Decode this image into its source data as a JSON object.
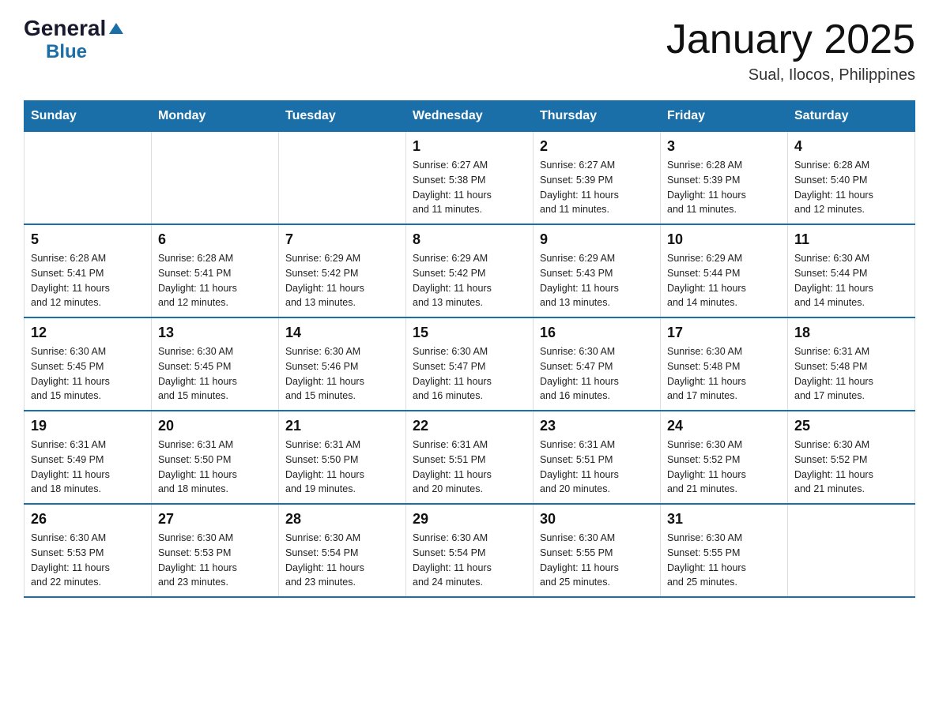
{
  "header": {
    "logo": {
      "general": "General",
      "blue": "Blue",
      "arrow": "▲"
    },
    "title": "January 2025",
    "subtitle": "Sual, Ilocos, Philippines"
  },
  "columns": [
    "Sunday",
    "Monday",
    "Tuesday",
    "Wednesday",
    "Thursday",
    "Friday",
    "Saturday"
  ],
  "weeks": [
    [
      {
        "day": "",
        "info": ""
      },
      {
        "day": "",
        "info": ""
      },
      {
        "day": "",
        "info": ""
      },
      {
        "day": "1",
        "info": "Sunrise: 6:27 AM\nSunset: 5:38 PM\nDaylight: 11 hours\nand 11 minutes."
      },
      {
        "day": "2",
        "info": "Sunrise: 6:27 AM\nSunset: 5:39 PM\nDaylight: 11 hours\nand 11 minutes."
      },
      {
        "day": "3",
        "info": "Sunrise: 6:28 AM\nSunset: 5:39 PM\nDaylight: 11 hours\nand 11 minutes."
      },
      {
        "day": "4",
        "info": "Sunrise: 6:28 AM\nSunset: 5:40 PM\nDaylight: 11 hours\nand 12 minutes."
      }
    ],
    [
      {
        "day": "5",
        "info": "Sunrise: 6:28 AM\nSunset: 5:41 PM\nDaylight: 11 hours\nand 12 minutes."
      },
      {
        "day": "6",
        "info": "Sunrise: 6:28 AM\nSunset: 5:41 PM\nDaylight: 11 hours\nand 12 minutes."
      },
      {
        "day": "7",
        "info": "Sunrise: 6:29 AM\nSunset: 5:42 PM\nDaylight: 11 hours\nand 13 minutes."
      },
      {
        "day": "8",
        "info": "Sunrise: 6:29 AM\nSunset: 5:42 PM\nDaylight: 11 hours\nand 13 minutes."
      },
      {
        "day": "9",
        "info": "Sunrise: 6:29 AM\nSunset: 5:43 PM\nDaylight: 11 hours\nand 13 minutes."
      },
      {
        "day": "10",
        "info": "Sunrise: 6:29 AM\nSunset: 5:44 PM\nDaylight: 11 hours\nand 14 minutes."
      },
      {
        "day": "11",
        "info": "Sunrise: 6:30 AM\nSunset: 5:44 PM\nDaylight: 11 hours\nand 14 minutes."
      }
    ],
    [
      {
        "day": "12",
        "info": "Sunrise: 6:30 AM\nSunset: 5:45 PM\nDaylight: 11 hours\nand 15 minutes."
      },
      {
        "day": "13",
        "info": "Sunrise: 6:30 AM\nSunset: 5:45 PM\nDaylight: 11 hours\nand 15 minutes."
      },
      {
        "day": "14",
        "info": "Sunrise: 6:30 AM\nSunset: 5:46 PM\nDaylight: 11 hours\nand 15 minutes."
      },
      {
        "day": "15",
        "info": "Sunrise: 6:30 AM\nSunset: 5:47 PM\nDaylight: 11 hours\nand 16 minutes."
      },
      {
        "day": "16",
        "info": "Sunrise: 6:30 AM\nSunset: 5:47 PM\nDaylight: 11 hours\nand 16 minutes."
      },
      {
        "day": "17",
        "info": "Sunrise: 6:30 AM\nSunset: 5:48 PM\nDaylight: 11 hours\nand 17 minutes."
      },
      {
        "day": "18",
        "info": "Sunrise: 6:31 AM\nSunset: 5:48 PM\nDaylight: 11 hours\nand 17 minutes."
      }
    ],
    [
      {
        "day": "19",
        "info": "Sunrise: 6:31 AM\nSunset: 5:49 PM\nDaylight: 11 hours\nand 18 minutes."
      },
      {
        "day": "20",
        "info": "Sunrise: 6:31 AM\nSunset: 5:50 PM\nDaylight: 11 hours\nand 18 minutes."
      },
      {
        "day": "21",
        "info": "Sunrise: 6:31 AM\nSunset: 5:50 PM\nDaylight: 11 hours\nand 19 minutes."
      },
      {
        "day": "22",
        "info": "Sunrise: 6:31 AM\nSunset: 5:51 PM\nDaylight: 11 hours\nand 20 minutes."
      },
      {
        "day": "23",
        "info": "Sunrise: 6:31 AM\nSunset: 5:51 PM\nDaylight: 11 hours\nand 20 minutes."
      },
      {
        "day": "24",
        "info": "Sunrise: 6:30 AM\nSunset: 5:52 PM\nDaylight: 11 hours\nand 21 minutes."
      },
      {
        "day": "25",
        "info": "Sunrise: 6:30 AM\nSunset: 5:52 PM\nDaylight: 11 hours\nand 21 minutes."
      }
    ],
    [
      {
        "day": "26",
        "info": "Sunrise: 6:30 AM\nSunset: 5:53 PM\nDaylight: 11 hours\nand 22 minutes."
      },
      {
        "day": "27",
        "info": "Sunrise: 6:30 AM\nSunset: 5:53 PM\nDaylight: 11 hours\nand 23 minutes."
      },
      {
        "day": "28",
        "info": "Sunrise: 6:30 AM\nSunset: 5:54 PM\nDaylight: 11 hours\nand 23 minutes."
      },
      {
        "day": "29",
        "info": "Sunrise: 6:30 AM\nSunset: 5:54 PM\nDaylight: 11 hours\nand 24 minutes."
      },
      {
        "day": "30",
        "info": "Sunrise: 6:30 AM\nSunset: 5:55 PM\nDaylight: 11 hours\nand 25 minutes."
      },
      {
        "day": "31",
        "info": "Sunrise: 6:30 AM\nSunset: 5:55 PM\nDaylight: 11 hours\nand 25 minutes."
      },
      {
        "day": "",
        "info": ""
      }
    ]
  ]
}
